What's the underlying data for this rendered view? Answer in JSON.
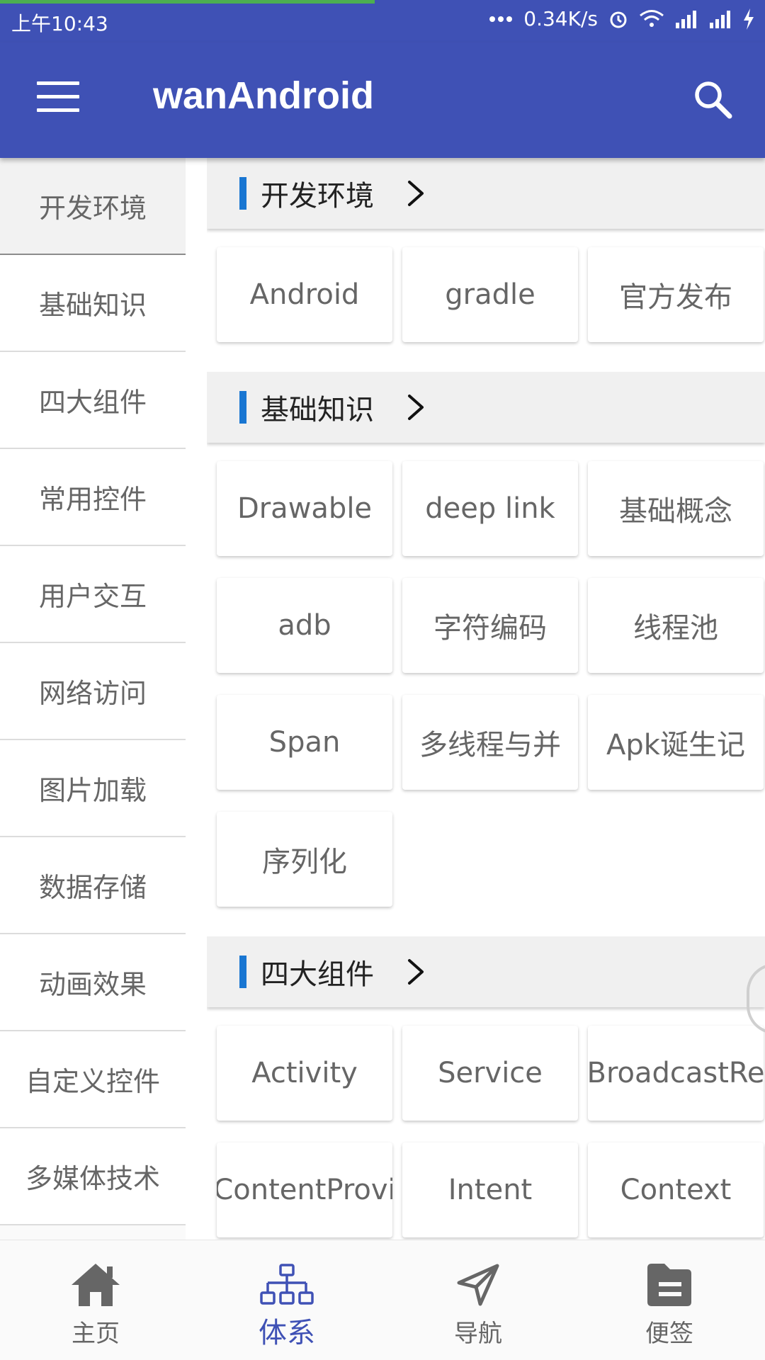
{
  "status_bar": {
    "time": "上午10:43",
    "speed": "0.34K/s",
    "load_progress": 0.49
  },
  "app_bar": {
    "title": "wanAndroid",
    "menu_icon": "menu-icon",
    "search_icon": "search-icon"
  },
  "categories": [
    {
      "label": "开发环境"
    },
    {
      "label": "基础知识"
    },
    {
      "label": "四大组件"
    },
    {
      "label": "常用控件"
    },
    {
      "label": "用户交互"
    },
    {
      "label": "网络访问"
    },
    {
      "label": "图片加载"
    },
    {
      "label": "数据存储"
    },
    {
      "label": "动画效果"
    },
    {
      "label": "自定义控件"
    },
    {
      "label": "多媒体技术"
    }
  ],
  "sections": [
    {
      "title": "开发环境",
      "tags": [
        "Android",
        "gradle",
        "官方发布"
      ]
    },
    {
      "title": "基础知识",
      "tags": [
        "Drawable",
        "deep link",
        "基础概念",
        "adb",
        "字符编码",
        "线程池",
        "Span",
        "多线程与并",
        "Apk诞生记",
        "序列化"
      ]
    },
    {
      "title": "四大组件",
      "tags": [
        "Activity",
        "Service",
        "BroadcastRe",
        "ContentProvi",
        "Intent",
        "Context"
      ]
    }
  ],
  "bottom_nav": [
    {
      "label": "主页",
      "icon": "home-icon",
      "active": false
    },
    {
      "label": "体系",
      "icon": "hierarchy-icon",
      "active": true
    },
    {
      "label": "导航",
      "icon": "navigation-icon",
      "active": false
    },
    {
      "label": "便签",
      "icon": "note-icon",
      "active": false
    }
  ],
  "colors": {
    "primary": "#3f51b5",
    "accent_bar": "#1976d2",
    "progress": "#4caf50"
  }
}
